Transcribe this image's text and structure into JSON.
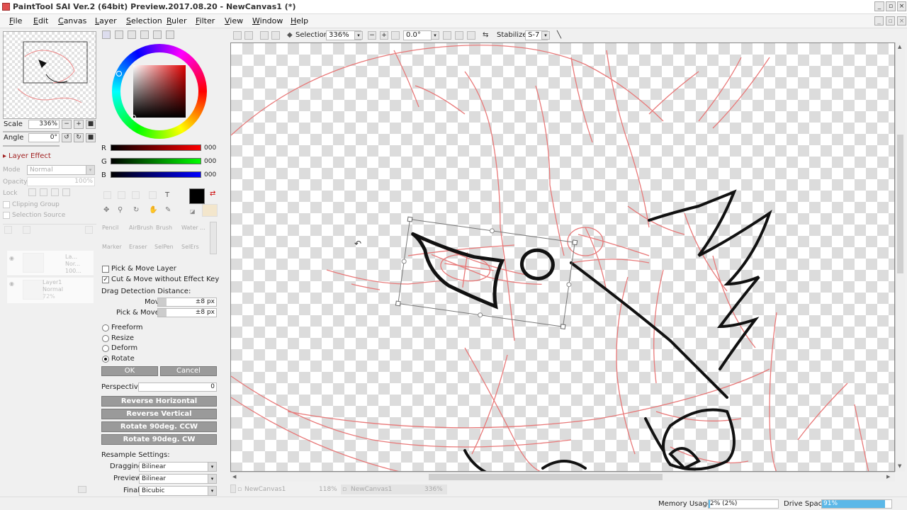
{
  "window": {
    "title": "PaintTool SAI Ver.2 (64bit) Preview.2017.08.20 - NewCanvas1 (*)"
  },
  "menu": [
    "File",
    "Edit",
    "Canvas",
    "Layer",
    "Selection",
    "Ruler",
    "Filter",
    "View",
    "Window",
    "Help"
  ],
  "toolbar": {
    "selection_label": "Selection",
    "zoom": "336%",
    "angle": "0.0°",
    "stabilizer_label": "Stabilizer",
    "stabilizer_value": "S-7"
  },
  "navigator": {
    "scale_label": "Scale",
    "scale_value": "336%",
    "angle_label": "Angle",
    "angle_value": "0°"
  },
  "layer_panel": {
    "section_title": "Layer Effect",
    "mode_label": "Mode",
    "mode_value": "Normal",
    "opacity_label": "Opacity",
    "opacity_value": "100%",
    "lock_label": "Lock",
    "clipping_label": "Clipping Group",
    "selection_source_label": "Selection Source",
    "layers": [
      {
        "name": "La...",
        "sub1": "Nor...",
        "sub2": "100..."
      },
      {
        "name": "Layer1",
        "sub1": "Normal",
        "sub2": "72%"
      }
    ]
  },
  "color": {
    "r_label": "R",
    "r_value": "000",
    "g_label": "G",
    "g_value": "000",
    "b_label": "B",
    "b_value": "000"
  },
  "tools": {
    "text_icon": "T",
    "brushes": [
      "Pencil",
      "AirBrush",
      "Brush",
      "Water ...",
      "Marker",
      "Eraser",
      "SelPen",
      "SelErs"
    ]
  },
  "options": {
    "pick_move_layer": "Pick & Move Layer",
    "cut_move": "Cut & Move without Effect Key",
    "drag_detection": "Drag Detection Distance:",
    "move_label": "Move",
    "move_value": "±8 px",
    "pick_move_label": "Pick & Move",
    "pick_move_value": "±8 px",
    "modes": [
      {
        "label": "Freeform",
        "checked": false
      },
      {
        "label": "Resize",
        "checked": false
      },
      {
        "label": "Deform",
        "checked": false
      },
      {
        "label": "Rotate",
        "checked": true
      }
    ],
    "ok": "OK",
    "cancel": "Cancel",
    "perspective_label": "Perspective",
    "perspective_value": "0",
    "reverse_h": "Reverse Horizontal",
    "reverse_v": "Reverse Vertical",
    "rot_ccw": "Rotate 90deg. CCW",
    "rot_cw": "Rotate 90deg. CW",
    "resample_label": "Resample Settings:",
    "dragging_label": "Dragging",
    "dragging_value": "Bilinear",
    "preview_label": "Preview",
    "preview_value": "Bilinear",
    "final_label": "Final",
    "final_value": "Bicubic"
  },
  "tabs": [
    {
      "name": "NewCanvas1",
      "zoom": "118%"
    },
    {
      "name": "NewCanvas1",
      "zoom": "336%"
    }
  ],
  "status": {
    "memory_label": "Memory Usage",
    "memory_value": "2% (2%)",
    "drive_label": "Drive Space",
    "drive_value": "91%",
    "drive_fraction": 0.91
  }
}
